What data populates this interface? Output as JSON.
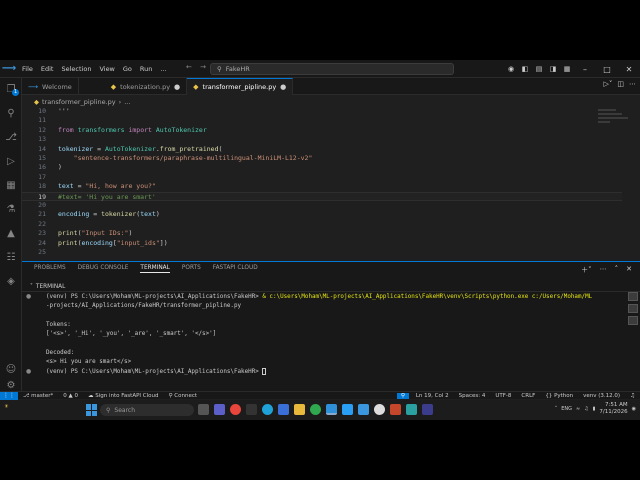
{
  "menu": [
    "File",
    "Edit",
    "Selection",
    "View",
    "Go",
    "Run",
    "..."
  ],
  "command_center": "FakeHR",
  "tabs": [
    {
      "label": "Welcome",
      "icon": "vscode-icon"
    },
    {
      "label": "tokenization.py",
      "icon": "python-icon",
      "modified": true
    },
    {
      "label": "transformer_pipline.py",
      "icon": "python-icon",
      "modified": true,
      "active": true
    }
  ],
  "breadcrumb": [
    "transformer_pipline.py",
    "..."
  ],
  "editor": {
    "lines": [
      {
        "n": "10",
        "parts": [
          [
            "",
            "'''"
          ]
        ]
      },
      {
        "n": "11",
        "parts": [
          [
            "",
            ""
          ]
        ]
      },
      {
        "n": "12",
        "parts": [
          [
            "kw",
            "from"
          ],
          [
            "",
            " "
          ],
          [
            "cls",
            "transformers"
          ],
          [
            "",
            " "
          ],
          [
            "kw",
            "import"
          ],
          [
            "",
            " "
          ],
          [
            "cls",
            "AutoTokenizer"
          ]
        ]
      },
      {
        "n": "13",
        "parts": [
          [
            "",
            ""
          ]
        ]
      },
      {
        "n": "14",
        "parts": [
          [
            "var",
            "tokenizer"
          ],
          [
            "",
            " = "
          ],
          [
            "cls",
            "AutoTokenizer"
          ],
          [
            "",
            "."
          ],
          [
            "fn",
            "from_pretrained"
          ],
          [
            "",
            "("
          ]
        ]
      },
      {
        "n": "15",
        "parts": [
          [
            "",
            "    "
          ],
          [
            "str",
            "\"sentence-transformers/paraphrase-multilingual-MiniLM-L12-v2\""
          ]
        ]
      },
      {
        "n": "16",
        "parts": [
          [
            "",
            ")"
          ]
        ]
      },
      {
        "n": "17",
        "parts": [
          [
            "",
            ""
          ]
        ]
      },
      {
        "n": "18",
        "parts": [
          [
            "var",
            "text"
          ],
          [
            "",
            " = "
          ],
          [
            "str",
            "\"Hi, how are you?\""
          ]
        ]
      },
      {
        "n": "19",
        "parts": [
          [
            "cmt",
            "#text= 'Hi you are smart'"
          ]
        ],
        "current": true
      },
      {
        "n": "20",
        "parts": [
          [
            "",
            ""
          ]
        ]
      },
      {
        "n": "21",
        "parts": [
          [
            "var",
            "encoding"
          ],
          [
            "",
            " = "
          ],
          [
            "fn",
            "tokenizer"
          ],
          [
            "",
            "("
          ],
          [
            "var",
            "text"
          ],
          [
            "",
            ")"
          ]
        ]
      },
      {
        "n": "22",
        "parts": [
          [
            "",
            ""
          ]
        ]
      },
      {
        "n": "23",
        "parts": [
          [
            "fn",
            "print"
          ],
          [
            "",
            "("
          ],
          [
            "str",
            "\"Input IDs:\""
          ],
          [
            "",
            ")"
          ]
        ]
      },
      {
        "n": "24",
        "parts": [
          [
            "fn",
            "print"
          ],
          [
            "",
            "("
          ],
          [
            "var",
            "encoding"
          ],
          [
            "",
            "["
          ],
          [
            "str",
            "\"input_ids\""
          ],
          [
            "",
            "])"
          ]
        ]
      },
      {
        "n": "25",
        "parts": [
          [
            "",
            ""
          ]
        ]
      }
    ]
  },
  "panel": {
    "tabs": [
      "PROBLEMS",
      "DEBUG CONSOLE",
      "TERMINAL",
      "PORTS",
      "FASTAPI CLOUD"
    ],
    "active_tab": "TERMINAL",
    "terminal_label": "TERMINAL"
  },
  "terminal": {
    "line1_prompt": "(venv) PS C:\\Users\\Moham\\ML-projects\\AI_Applications\\FakeHR> ",
    "line1_cmd": "& c:\\Users\\Moham\\ML-projects\\AI_Applications\\FakeHR\\venv\\Scripts\\python.exe c:/Users/Moham/ML",
    "line2": "-projects/AI_Applications/FakeHR/transformer_pipline.py",
    "tokens_label": "Tokens:",
    "tokens_value": "['<s>', '_Hi', '_you', '_are', '_smart', '</s>']",
    "decoded_label": "Decoded:",
    "decoded_value": "<s> Hi you are smart</s>",
    "last_prompt": "(venv) PS C:\\Users\\Moham\\ML-projects\\AI_Applications\\FakeHR> "
  },
  "statusbar": {
    "branch": "master*",
    "sync": "0 ▲ 0",
    "fastapi": "Sign into FastAPI Cloud",
    "connect": "Connect",
    "position": "Ln 19, Col 2",
    "spaces": "Spaces: 4",
    "encoding": "UTF-8",
    "eol": "CRLF",
    "language": "Python",
    "interpreter": "venv (3.12.0)"
  },
  "taskbar": {
    "search_placeholder": "Search",
    "lang": "ENG",
    "time": "7:51 AM",
    "date": "7/11/2026"
  }
}
